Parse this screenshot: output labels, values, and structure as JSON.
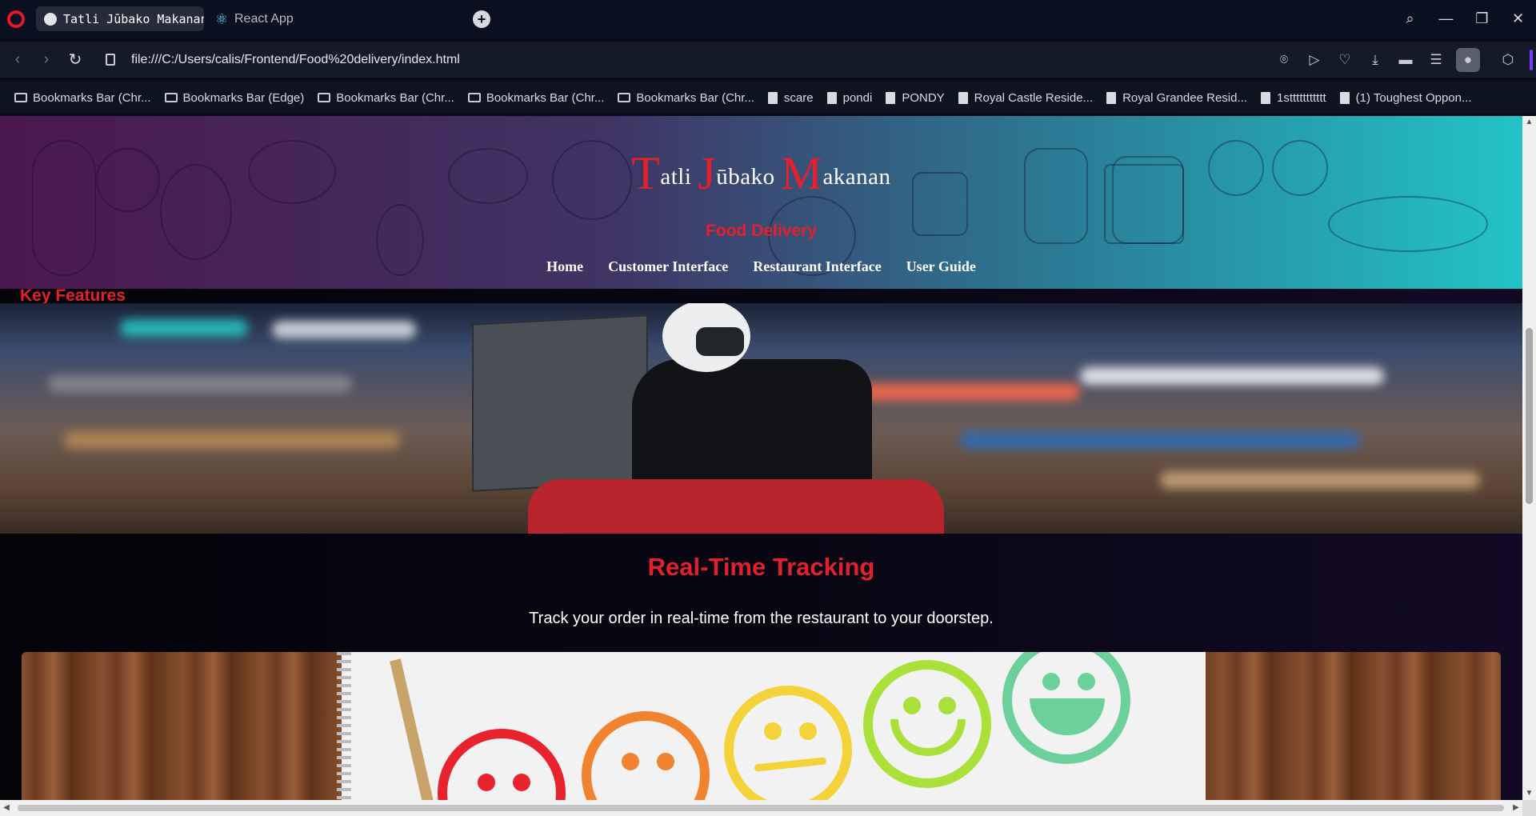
{
  "browser": {
    "tabs": [
      {
        "title": "Tatli Jūbako Makanan D",
        "active": true,
        "icon": "globe-icon"
      },
      {
        "title": "React App",
        "active": false,
        "icon": "react-icon"
      }
    ],
    "url": "file:///C:/Users/calis/Frontend/Food%20delivery/index.html",
    "bookmarks": [
      {
        "label": "Bookmarks Bar (Chr...",
        "type": "folder"
      },
      {
        "label": "Bookmarks Bar (Edge)",
        "type": "folder"
      },
      {
        "label": "Bookmarks Bar (Chr...",
        "type": "folder"
      },
      {
        "label": "Bookmarks Bar (Chr...",
        "type": "folder"
      },
      {
        "label": "Bookmarks Bar (Chr...",
        "type": "folder"
      },
      {
        "label": "scare",
        "type": "page"
      },
      {
        "label": "pondi",
        "type": "page"
      },
      {
        "label": "PONDY",
        "type": "page"
      },
      {
        "label": "Royal Castle Reside...",
        "type": "page"
      },
      {
        "label": "Royal Grandee Resid...",
        "type": "page"
      },
      {
        "label": "1sttttttttttt",
        "type": "page"
      },
      {
        "label": "(1) Toughest Oppon...",
        "type": "page"
      }
    ]
  },
  "site": {
    "brand": {
      "t": "T",
      "t_rest": "atli ",
      "j": "J",
      "j_rest": "ūbako ",
      "m": "M",
      "m_rest": "akanan"
    },
    "tagline": "Food Delivery",
    "nav": [
      "Home",
      "Customer Interface",
      "Restaurant Interface",
      "User Guide"
    ],
    "section_title": "Key Features",
    "feature": {
      "title": "Real-Time Tracking",
      "description": "Track your order in real-time from the restaurant to your doorstep."
    }
  },
  "colors": {
    "accent_red": "#e5202e",
    "header_left": "#4b1850",
    "header_right": "#22c4c6"
  }
}
